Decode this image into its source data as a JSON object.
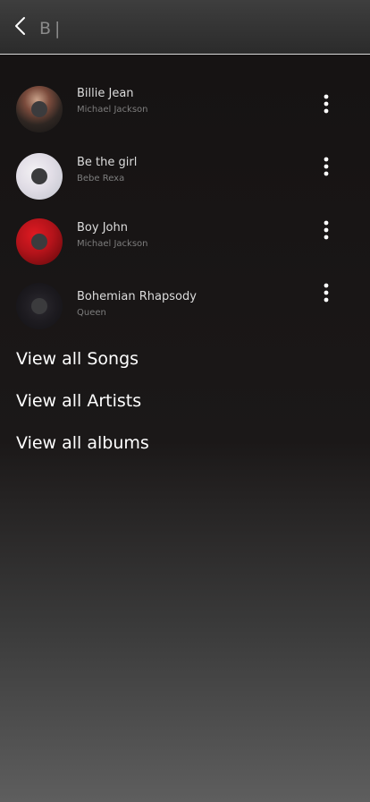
{
  "header": {
    "search_value": "B",
    "back_icon": "chevron-left-icon"
  },
  "songs": [
    {
      "title": "Billie Jean",
      "artist": "Michael Jackson",
      "cover_color": "#3a2a26"
    },
    {
      "title": "Be the girl",
      "artist": "Bebe Rexa",
      "cover_color": "#e7e4ea"
    },
    {
      "title": "Boy John",
      "artist": "Michael Jackson",
      "cover_color": "#b51218"
    },
    {
      "title": "Bohemian Rhapsody",
      "artist": "Queen",
      "cover_color": "#1a1a1d"
    }
  ],
  "links": {
    "songs": "View all Songs",
    "artists": "View all Artists",
    "albums": "View all albums"
  },
  "colors": {
    "header_bg": "#333333",
    "divider": "#d9d9d9",
    "title_text": "#dcdcdc",
    "subtitle_text": "#7d7d7d"
  }
}
